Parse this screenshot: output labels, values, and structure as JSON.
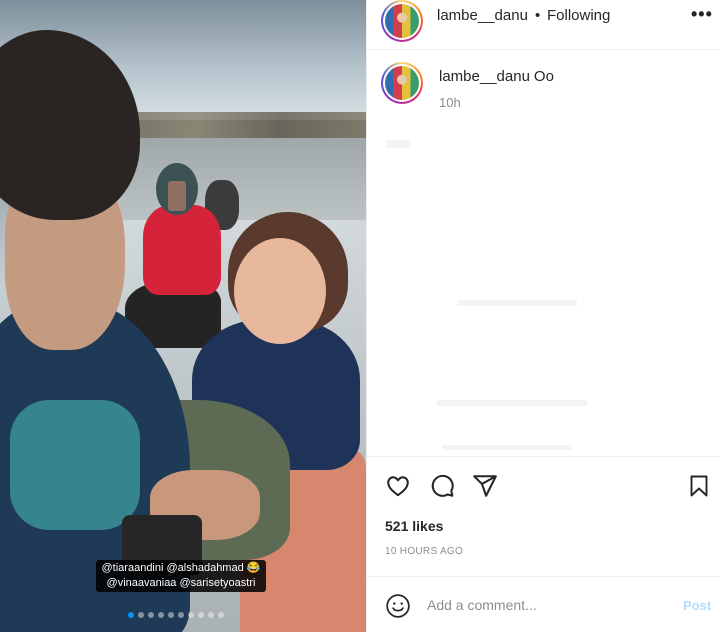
{
  "post": {
    "username": "lambe__danu",
    "separator": "•",
    "follow_status": "Following",
    "more": "•••",
    "caption_text": "Oo",
    "time_ago_short": "10h",
    "likes": "521 likes",
    "time_ago_long": "10 HOURS AGO"
  },
  "media": {
    "tag_line_1": "@tiaraandini @alshadahmad 😂",
    "tag_line_2": "@vinaavaniaa @sarisetyoastri",
    "carousel_dots": 10,
    "active_dot": 0
  },
  "comment_box": {
    "placeholder": "Add a comment...",
    "post_label": "Post"
  },
  "icons": [
    "heart-icon",
    "comment-icon",
    "share-icon",
    "bookmark-icon",
    "emoji-icon",
    "more-icon"
  ],
  "colors": {
    "accent": "#0095f6",
    "post_disabled": "#b3dbff",
    "muted": "#8e8e8e"
  }
}
